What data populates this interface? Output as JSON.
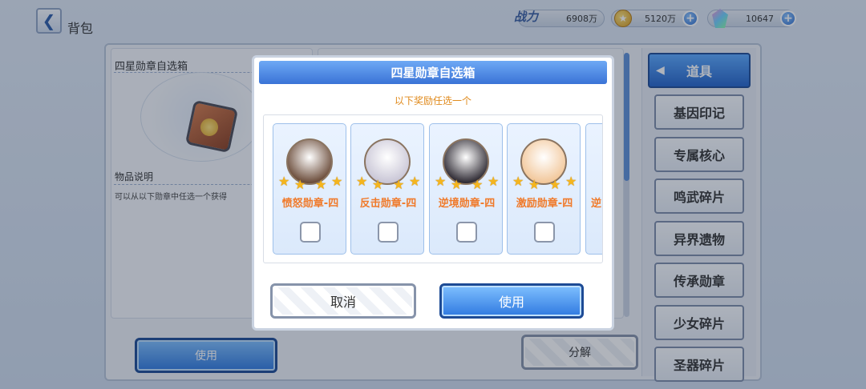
{
  "header": {
    "title": "背包",
    "power_label": "战力",
    "power_value": "6908万",
    "coins": "5120万",
    "gems": "10647"
  },
  "item_panel": {
    "title": "四星勋章自选箱",
    "desc_title": "物品说明",
    "desc_text": "可以从以下勋章中任选一个获得"
  },
  "bottom_buttons": {
    "use": "使用",
    "decompose": "分解"
  },
  "tabs": [
    {
      "label": "道具",
      "active": true
    },
    {
      "label": "基因印记"
    },
    {
      "label": "专属核心"
    },
    {
      "label": "鸣武碎片"
    },
    {
      "label": "异界遗物"
    },
    {
      "label": "传承勋章"
    },
    {
      "label": "少女碎片"
    },
    {
      "label": "圣器碎片"
    }
  ],
  "modal": {
    "title": "四星勋章自选箱",
    "subtitle": "以下奖励任选一个",
    "rewards": [
      {
        "name": "愤怒勋章-四",
        "stars": 4,
        "color": "#6b4c3a"
      },
      {
        "name": "反击勋章-四",
        "stars": 4,
        "color": "#c9c6d6"
      },
      {
        "name": "逆境勋章-四",
        "stars": 4,
        "color": "#2e2a33"
      },
      {
        "name": "激励勋章-四",
        "stars": 4,
        "color": "#f2c79a"
      },
      {
        "name": "逆",
        "stars": 1,
        "color": "#999999"
      }
    ],
    "cancel": "取消",
    "confirm": "使用"
  }
}
